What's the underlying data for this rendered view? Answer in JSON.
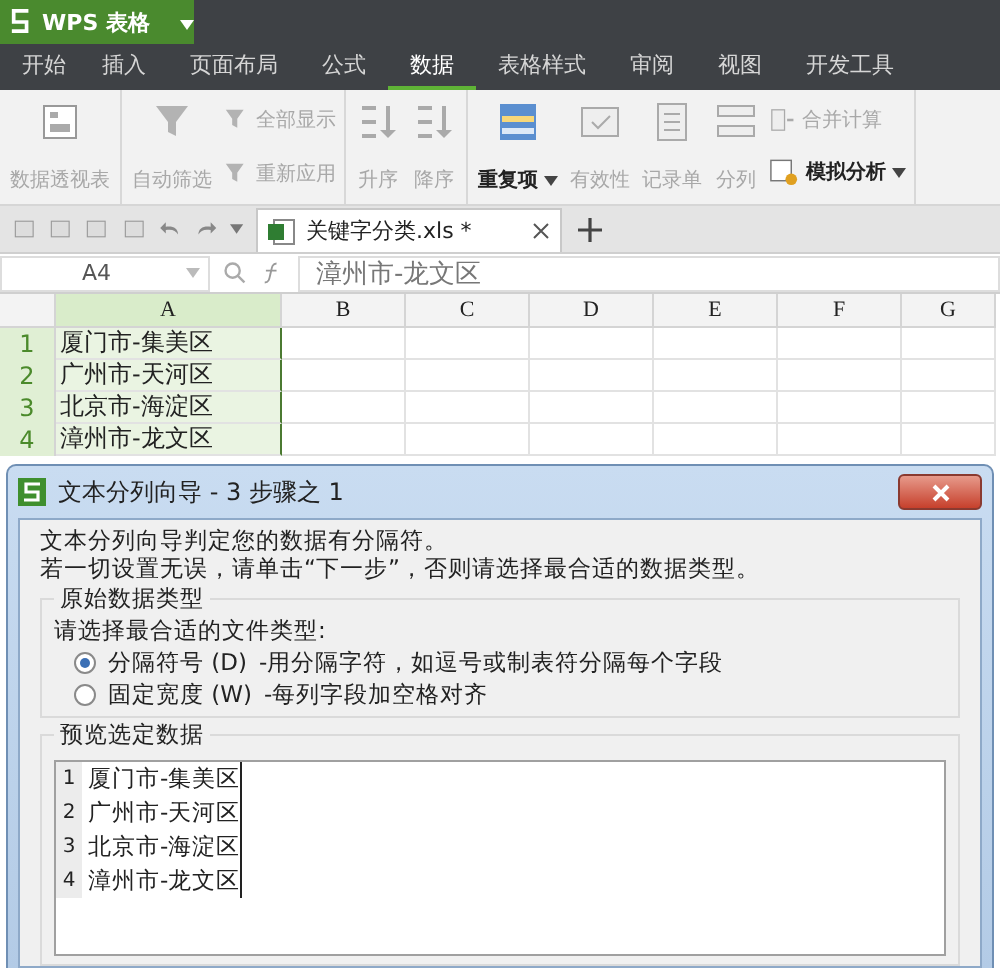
{
  "app": {
    "title": "WPS 表格"
  },
  "menu_tabs": [
    {
      "label": "开始",
      "selected": false
    },
    {
      "label": "插入",
      "selected": false
    },
    {
      "label": "页面布局",
      "selected": false
    },
    {
      "label": "公式",
      "selected": false
    },
    {
      "label": "数据",
      "selected": true
    },
    {
      "label": "表格样式",
      "selected": false
    },
    {
      "label": "审阅",
      "selected": false
    },
    {
      "label": "视图",
      "selected": false
    },
    {
      "label": "开发工具",
      "selected": false
    }
  ],
  "ribbon_groups": [
    {
      "items": [
        {
          "kind": "large",
          "label": "数据透视表",
          "disabled": true,
          "dropdown": false
        }
      ]
    },
    {
      "items": [
        {
          "kind": "large",
          "label": "自动筛选",
          "disabled": true,
          "dropdown": false
        },
        {
          "kind": "stack",
          "label": "全部显示",
          "disabled": true,
          "dropdown": false
        },
        {
          "kind": "stack",
          "label": "重新应用",
          "disabled": true,
          "dropdown": false
        }
      ]
    },
    {
      "items": [
        {
          "kind": "large",
          "label": "升序",
          "disabled": true,
          "dropdown": false
        },
        {
          "kind": "large",
          "label": "降序",
          "disabled": true,
          "dropdown": false
        }
      ]
    },
    {
      "items": [
        {
          "kind": "large",
          "label": "重复项",
          "disabled": false,
          "dropdown": true
        },
        {
          "kind": "large",
          "label": "有效性",
          "disabled": true,
          "dropdown": false
        },
        {
          "kind": "large",
          "label": "记录单",
          "disabled": true,
          "dropdown": false
        },
        {
          "kind": "large",
          "label": "分列",
          "disabled": true,
          "dropdown": false
        },
        {
          "kind": "stack",
          "label": "合并计算",
          "disabled": true,
          "dropdown": false
        },
        {
          "kind": "stack",
          "label": "模拟分析",
          "disabled": false,
          "dropdown": true
        }
      ]
    }
  ],
  "doc_tabs": [
    {
      "label": "关键字分类.xls *",
      "selected": true
    }
  ],
  "formula_bar": {
    "cell_ref": "A4",
    "value": "漳州市-龙文区"
  },
  "sheet": {
    "columns": [
      {
        "label": "A",
        "selected": true
      },
      {
        "label": "B",
        "selected": false
      },
      {
        "label": "C",
        "selected": false
      },
      {
        "label": "D",
        "selected": false
      },
      {
        "label": "E",
        "selected": false
      },
      {
        "label": "F",
        "selected": false
      },
      {
        "label": "G",
        "selected": false
      }
    ],
    "rows": [
      {
        "number": "1",
        "selected": true,
        "cells": [
          "厦门市-集美区"
        ]
      },
      {
        "number": "2",
        "selected": true,
        "cells": [
          "广州市-天河区"
        ]
      },
      {
        "number": "3",
        "selected": true,
        "cells": [
          "北京市-海淀区"
        ]
      },
      {
        "number": "4",
        "selected": true,
        "cells": [
          "漳州市-龙文区"
        ]
      }
    ]
  },
  "dialog": {
    "title": "文本分列向导 - 3 步骤之 1",
    "message": [
      "文本分列向导判定您的数据有分隔符。",
      "若一切设置无误，请单击“下一步”，否则请选择最合适的数据类型。"
    ],
    "type_group": {
      "title": "原始数据类型",
      "prompt": "请选择最合适的文件类型:",
      "options": [
        {
          "label": "分隔符号 (D)",
          "description": "-用分隔字符，如逗号或制表符分隔每个字段",
          "selected": true
        },
        {
          "label": "固定宽度 (W)",
          "description": "-每列字段加空格对齐",
          "selected": false
        }
      ]
    },
    "preview": {
      "title": "预览选定数据",
      "rows": [
        {
          "number": "1",
          "text": "厦门市-集美区"
        },
        {
          "number": "2",
          "text": "广州市-天河区"
        },
        {
          "number": "3",
          "text": "北京市-海淀区"
        },
        {
          "number": "4",
          "text": "漳州市-龙文区"
        }
      ]
    }
  }
}
